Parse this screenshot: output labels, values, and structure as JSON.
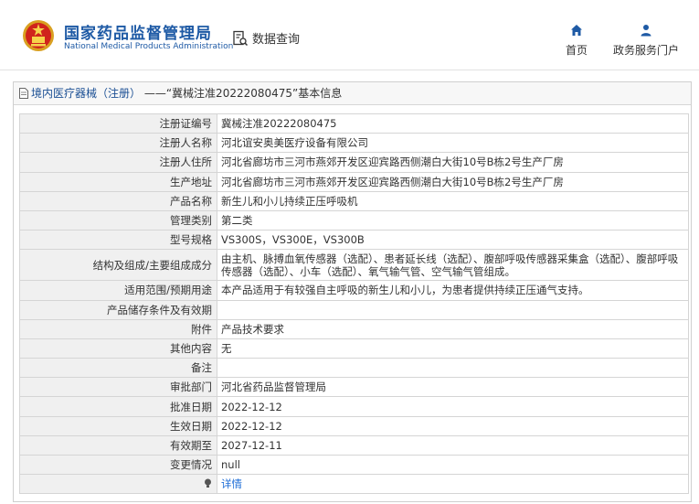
{
  "header": {
    "site_name_cn": "国家药品监督管理局",
    "site_name_en": "National Medical Products Administration",
    "query_label": "数据查询",
    "nav": [
      {
        "label": "首页",
        "icon": "home-icon"
      },
      {
        "label": "政务服务门户",
        "icon": "user-icon"
      }
    ]
  },
  "breadcrumb": {
    "category": "境内医疗器械（注册）",
    "separator": "——",
    "record_title": "“冀械注准20222080475”基本信息"
  },
  "rows": [
    {
      "label": "注册证编号",
      "value": "冀械注准20222080475"
    },
    {
      "label": "注册人名称",
      "value": "河北谊安奥美医疗设备有限公司"
    },
    {
      "label": "注册人住所",
      "value": "河北省廊坊市三河市燕郊开发区迎宾路西侧潮白大街10号B栋2号生产厂房"
    },
    {
      "label": "生产地址",
      "value": "河北省廊坊市三河市燕郊开发区迎宾路西侧潮白大街10号B栋2号生产厂房"
    },
    {
      "label": "产品名称",
      "value": "新生儿和小儿持续正压呼吸机"
    },
    {
      "label": "管理类别",
      "value": "第二类"
    },
    {
      "label": "型号规格",
      "value": "VS300S，VS300E，VS300B"
    },
    {
      "label": "结构及组成/主要组成成分",
      "value": "由主机、脉搏血氧传感器（选配）、患者延长线（选配）、腹部呼吸传感器采集盒（选配）、腹部呼吸传感器（选配）、小车（选配）、氧气输气管、空气输气管组成。"
    },
    {
      "label": "适用范围/预期用途",
      "value": "本产品适用于有较强自主呼吸的新生儿和小儿，为患者提供持续正压通气支持。"
    },
    {
      "label": "产品储存条件及有效期",
      "value": ""
    },
    {
      "label": "附件",
      "value": "产品技术要求"
    },
    {
      "label": "其他内容",
      "value": "无"
    },
    {
      "label": "备注",
      "value": ""
    },
    {
      "label": "审批部门",
      "value": "河北省药品监督管理局"
    },
    {
      "label": "批准日期",
      "value": "2022-12-12"
    },
    {
      "label": "生效日期",
      "value": "2022-12-12"
    },
    {
      "label": "有效期至",
      "value": "2027-12-11"
    },
    {
      "label": "变更情况",
      "value": "null"
    }
  ],
  "detail_link": "详情",
  "colors": {
    "brand_blue": "#1e5aa5",
    "link_blue": "#1b6bd6"
  }
}
